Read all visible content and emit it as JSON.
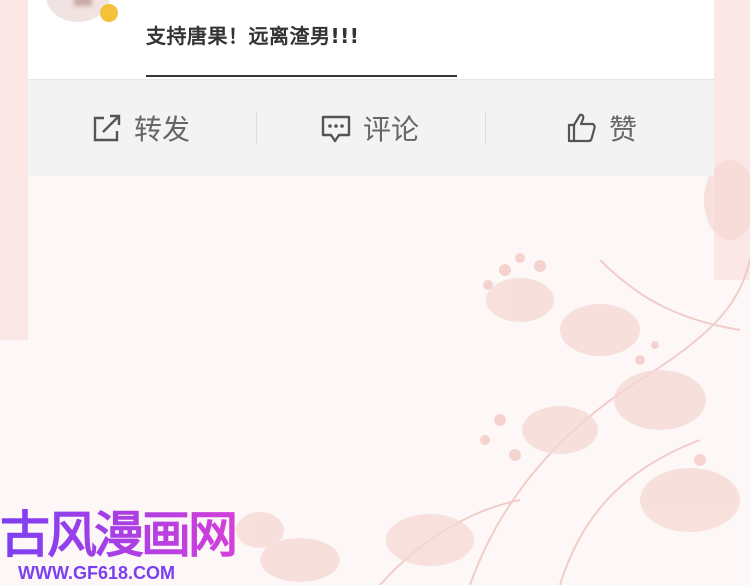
{
  "comment": {
    "text": "支持唐果！远离渣男!!!"
  },
  "actions": {
    "share": {
      "label": "转发",
      "icon": "share-icon"
    },
    "comment": {
      "label": "评论",
      "icon": "comment-icon"
    },
    "like": {
      "label": "赞",
      "icon": "thumbs-up-icon"
    }
  },
  "watermark": {
    "title": "古风漫画网",
    "url": "WWW.GF618.COM"
  },
  "colors": {
    "text": "#333333",
    "action_text": "#666666",
    "action_bar": "#f3f3f3",
    "watermark": "#8a3cf0"
  }
}
